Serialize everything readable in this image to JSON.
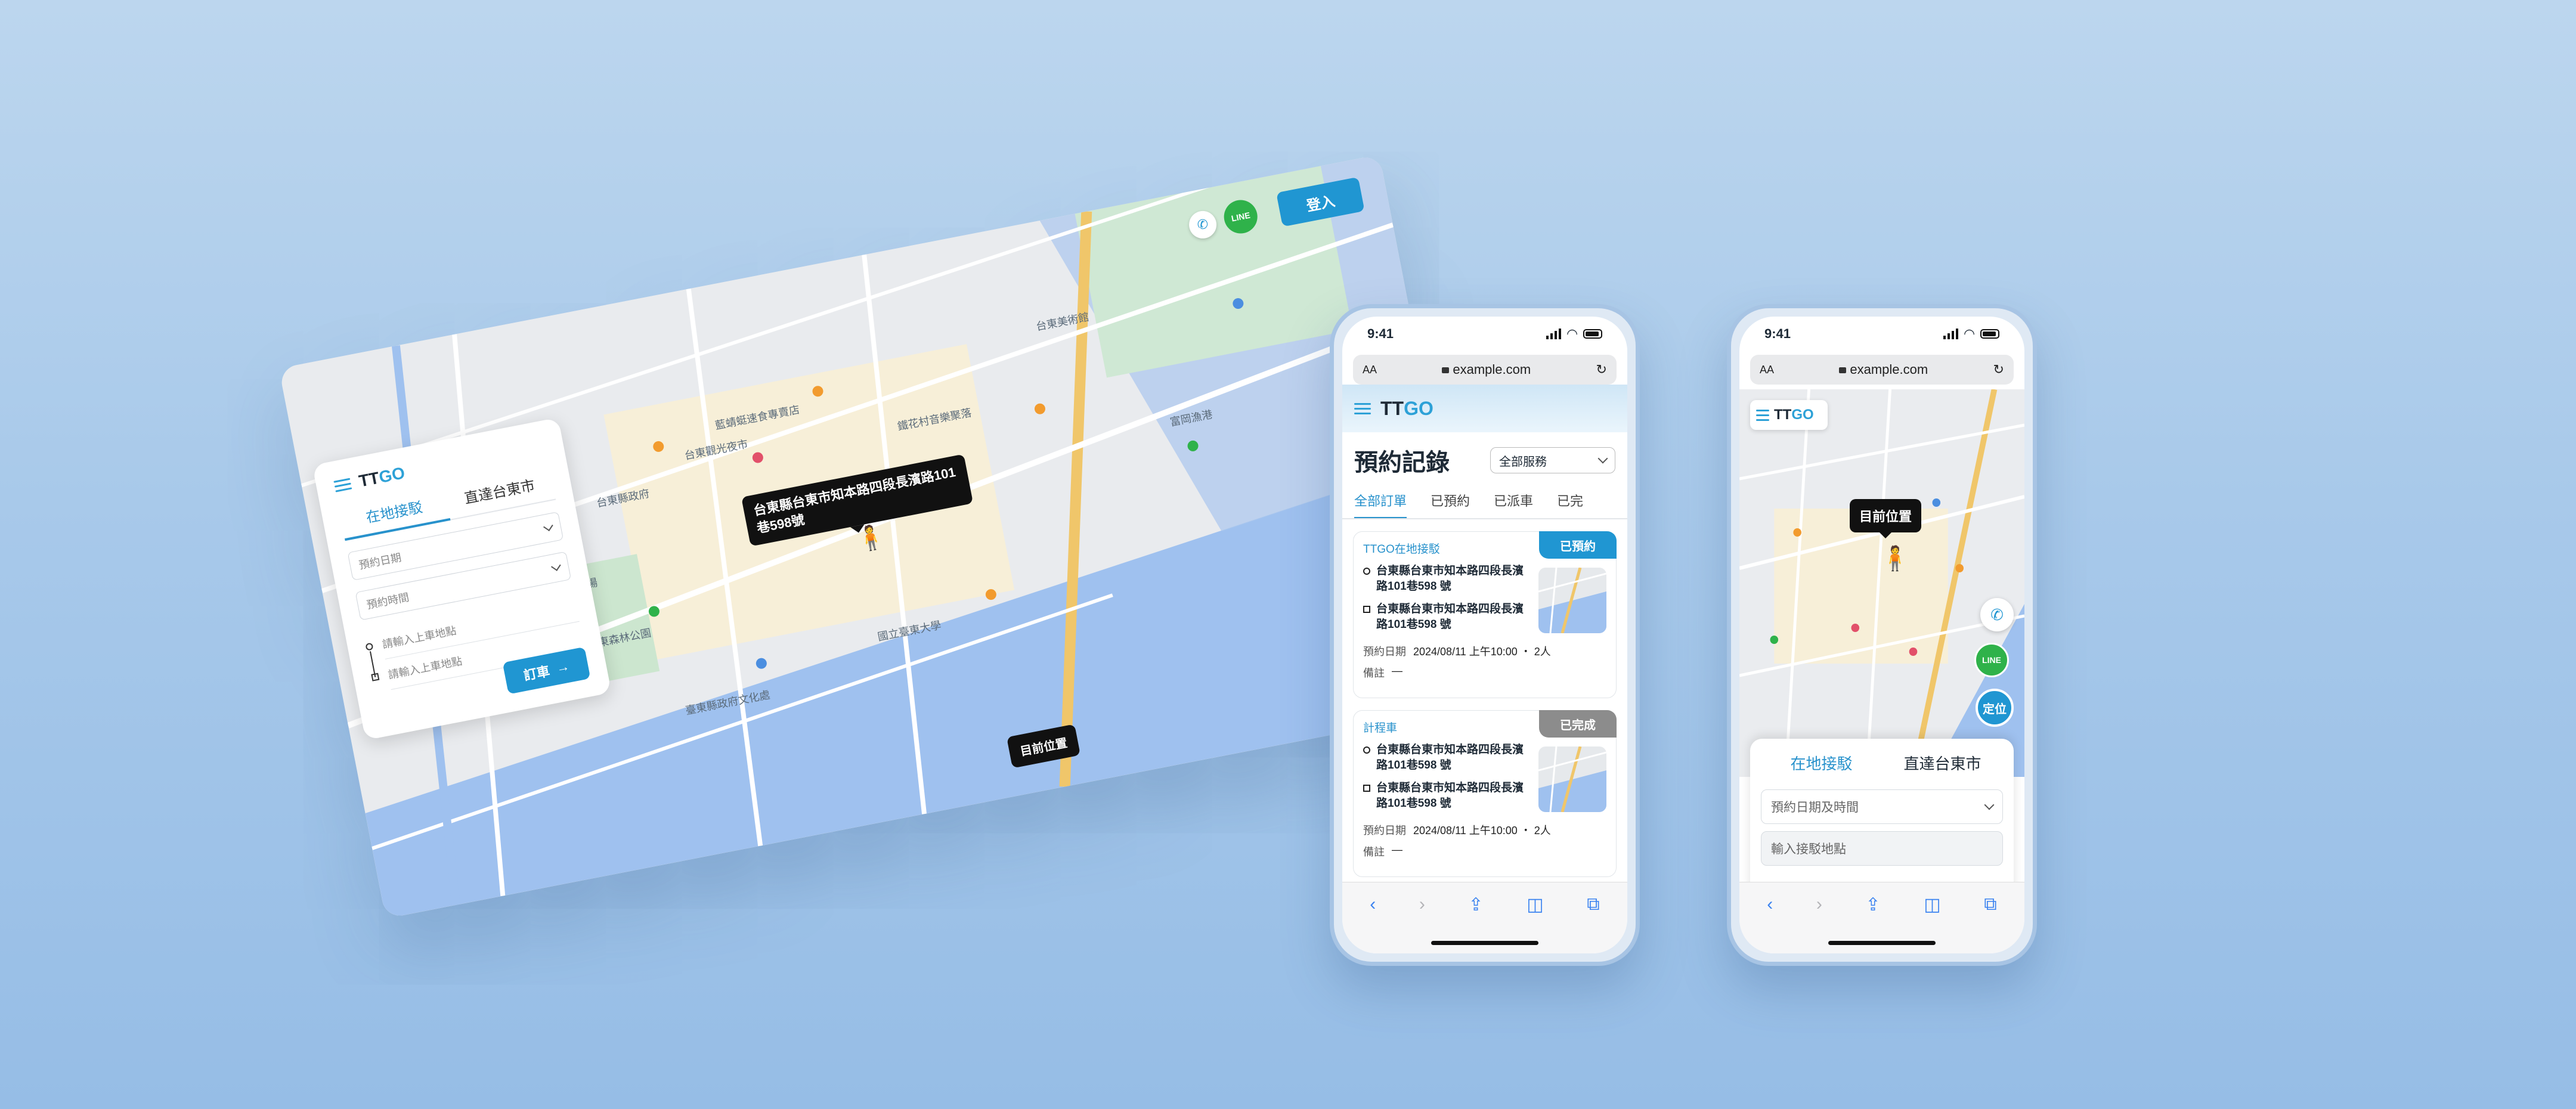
{
  "colors": {
    "brand": "#2096d2",
    "booked": "#2096d2",
    "completed": "#8c8c8c",
    "line": "#2fb24a"
  },
  "desktop": {
    "logo": {
      "tt": "TT",
      "go": "GO"
    },
    "tabs": [
      "在地接駁",
      "直達台東市"
    ],
    "date_placeholder": "預約日期",
    "time_placeholder": "預約時間",
    "pickup_placeholder": "請輸入上車地點",
    "dropoff_placeholder": "請輸入上車地點",
    "order_button": "訂車",
    "login_button": "登入",
    "address_bubble": "台東縣台東市知本路四段長濱路101巷598號",
    "current_location": "目前位置",
    "map_labels": [
      "台東縣政府",
      "台東觀光夜市",
      "台東森林公園",
      "國立臺東大學",
      "藍蜻蜓速食專賣店",
      "鐵花村音樂聚落",
      "臺東縣立體育場",
      "台東美術館",
      "富岡漁港",
      "臺東縣政府文化處"
    ]
  },
  "phone1": {
    "time": "9:41",
    "url": "example.com",
    "aa": "AA",
    "logo": {
      "tt": "TT",
      "go": "GO"
    },
    "title": "預約記錄",
    "filter": "全部服務",
    "tabs": [
      "全部訂單",
      "已預約",
      "已派車",
      "已完"
    ],
    "cards": [
      {
        "service": "TTGO在地接駁",
        "status": "已預約",
        "from": "台東縣台東市知本路四段長濱路101巷598 號",
        "to": "台東縣台東市知本路四段長濱路101巷598 號",
        "date_label": "預約日期",
        "date": "2024/08/11 上午10:00 ・ 2人",
        "note_label": "備註",
        "note": "—"
      },
      {
        "service": "計程車",
        "status": "已完成",
        "from": "台東縣台東市知本路四段長濱路101巷598 號",
        "to": "台東縣台東市知本路四段長濱路101巷598 號",
        "date_label": "預約日期",
        "date": "2024/08/11 上午10:00 ・ 2人",
        "note_label": "備註",
        "note": "—"
      }
    ]
  },
  "phone2": {
    "time": "9:41",
    "url": "example.com",
    "aa": "AA",
    "logo": {
      "tt": "TT",
      "go": "GO"
    },
    "current_location": "目前位置",
    "line_label": "LINE",
    "locate_button": "定位",
    "tabs": [
      "在地接駁",
      "直達台東市"
    ],
    "datetime_placeholder": "預約日期及時間",
    "pickup_placeholder": "輸入接駁地點"
  }
}
